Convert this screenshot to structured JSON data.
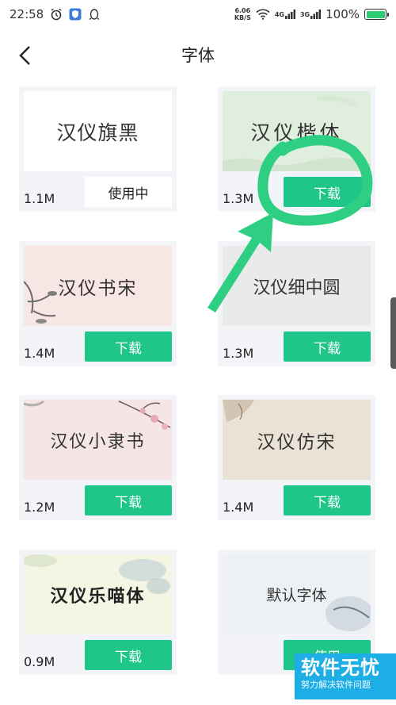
{
  "status_bar": {
    "time": "22:58",
    "net_speed_value": "6.06",
    "net_speed_unit": "KB/S",
    "signal1_label": "4G",
    "signal2_label": "3G",
    "battery": "100%",
    "battery_level": 1.0,
    "left_icons": [
      "alarm-icon",
      "shield-app-icon",
      "qq-penguin-icon"
    ],
    "right_icons": [
      "wifi-icon",
      "signal-4g-icon",
      "signal-3g-icon",
      "battery-icon"
    ]
  },
  "header": {
    "title": "字体",
    "back_icon": "chevron-left-icon"
  },
  "fonts": [
    {
      "name": "汉仪旗黑",
      "size": "1.1M",
      "action": "使用中",
      "state": "in-use",
      "bg": "#ffffff"
    },
    {
      "name": "汉仪楷体",
      "size": "1.3M",
      "action": "下载",
      "state": "download",
      "bg": "#dfeedd"
    },
    {
      "name": "汉仪书宋",
      "size": "1.4M",
      "action": "下载",
      "state": "download",
      "bg": "#f7e6e3"
    },
    {
      "name": "汉仪细中圆",
      "size": "1.3M",
      "action": "下载",
      "state": "download",
      "bg": "#e9ebeb"
    },
    {
      "name": "汉仪小隶书",
      "size": "1.2M",
      "action": "下载",
      "state": "download",
      "bg": "#f6e5e6"
    },
    {
      "name": "汉仪仿宋",
      "size": "1.4M",
      "action": "下载",
      "state": "download",
      "bg": "#ebe2d6"
    },
    {
      "name": "汉仪乐喵体",
      "size": "0.9M",
      "action": "下载",
      "state": "download",
      "bg": "#f4f5e2"
    },
    {
      "name": "默认字体",
      "size": "",
      "action": "使用",
      "state": "use",
      "bg": "#eef1f4"
    }
  ],
  "colors": {
    "accent": "#20c58a",
    "annotation": "#2ecf83",
    "watermark": "#1eaee6"
  },
  "watermark": {
    "title": "软件无忧",
    "subtitle": "努力解决软件问题"
  }
}
